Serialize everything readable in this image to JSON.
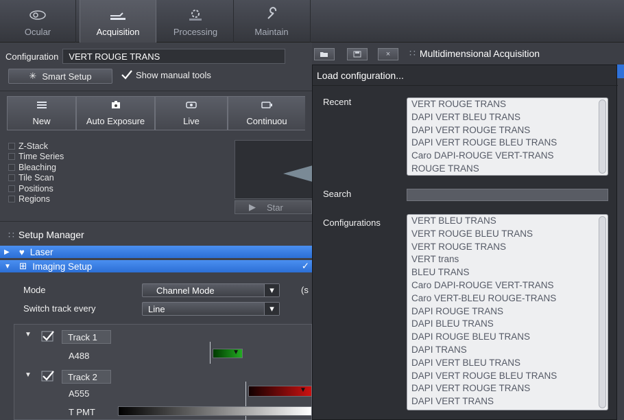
{
  "tabs": [
    {
      "label": "Ocular",
      "icon": "ocular-icon"
    },
    {
      "label": "Acquisition",
      "icon": "acquisition-icon"
    },
    {
      "label": "Processing",
      "icon": "processing-icon"
    },
    {
      "label": "Maintain",
      "icon": "maintain-icon"
    }
  ],
  "config": {
    "label": "Configuration",
    "value": "VERT ROUGE TRANS"
  },
  "smart_setup": {
    "label": "Smart Setup",
    "show_manual": "Show manual tools"
  },
  "toolbar": [
    {
      "label": "New",
      "icon": "new-icon"
    },
    {
      "label": "Auto Exposure",
      "icon": "camera-icon"
    },
    {
      "label": "Live",
      "icon": "live-icon"
    },
    {
      "label": "Continuou",
      "icon": "continuous-icon"
    }
  ],
  "experiments": [
    "Z-Stack",
    "Time Series",
    "Bleaching",
    "Tile Scan",
    "Positions",
    "Regions"
  ],
  "start_label": "Star",
  "setup_manager": {
    "title": "Setup Manager",
    "laser": "Laser",
    "imaging_setup": "Imaging Setup",
    "mode_label": "Mode",
    "mode_value": "Channel Mode",
    "mode_extra": "(s",
    "switch_label": "Switch track every",
    "switch_value": "Line"
  },
  "tracks": [
    {
      "name": "Track 1",
      "channels": [
        {
          "name": "A488",
          "color": "#22aa22"
        }
      ]
    },
    {
      "name": "Track 2",
      "channels": [
        {
          "name": "A555",
          "color": "#cc1111"
        },
        {
          "name": "T PMT",
          "color": "#ffffff"
        }
      ]
    }
  ],
  "multidim": {
    "title": "Multidimensional Acquisition"
  },
  "popup": {
    "title": "Load configuration...",
    "recent_label": "Recent",
    "recent": [
      "VERT ROUGE TRANS",
      "DAPI VERT BLEU TRANS",
      "DAPI VERT ROUGE TRANS",
      "DAPI VERT ROUGE BLEU TRANS",
      "Caro DAPI-ROUGE VERT-TRANS",
      "ROUGE TRANS"
    ],
    "search_label": "Search",
    "search_value": "",
    "configurations_label": "Configurations",
    "configurations": [
      "VERT  BLEU TRANS",
      "VERT ROUGE BLEU TRANS",
      "VERT ROUGE TRANS",
      "VERT trans",
      "BLEU TRANS",
      "Caro DAPI-ROUGE VERT-TRANS",
      "Caro VERT-BLEU ROUGE-TRANS",
      "DAPI  ROUGE TRANS",
      "DAPI BLEU TRANS",
      "DAPI ROUGE BLEU TRANS",
      "DAPI TRANS",
      "DAPI VERT BLEU TRANS",
      "DAPI VERT ROUGE BLEU TRANS",
      "DAPI VERT ROUGE TRANS",
      "DAPI VERT TRANS"
    ]
  },
  "colors": {
    "accent_blue": "#2f72da",
    "list_bg": "#eeeff1"
  }
}
